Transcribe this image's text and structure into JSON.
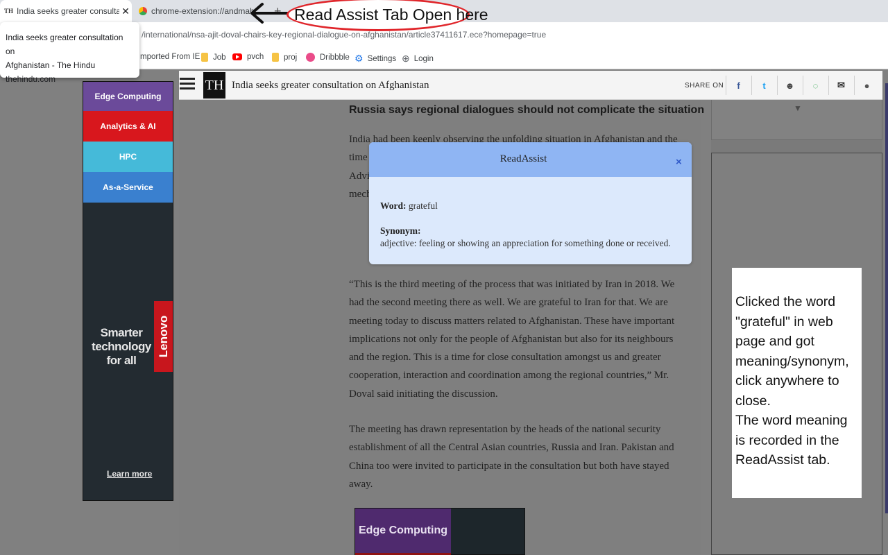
{
  "browser": {
    "tabs": [
      {
        "title": "India seeks greater consultation on",
        "favicon": "TH"
      },
      {
        "title": "chrome-extension://andmahekc"
      }
    ],
    "new_tab_symbol": "+",
    "url": "/international/nsa-ajit-doval-chairs-key-regional-dialogue-on-afghanistan/article37411617.ece?homepage=true",
    "bookmarks": [
      "mported From IE",
      "Job",
      "pvch",
      "proj",
      "Dribbble",
      "Settings",
      "Login"
    ],
    "hover_card": {
      "title_line1": "India seeks greater consultation on",
      "title_line2": "Afghanistan - The Hindu",
      "domain": "thehindu.com"
    }
  },
  "annotation_top": {
    "text": "Read Assist Tab Open here",
    "color": "#e0262b"
  },
  "site": {
    "logo": "TH",
    "headline": "India seeks greater consultation on Afghanistan",
    "share_label": "SHARE ON",
    "share_icons": [
      "facebook-icon",
      "twitter-icon",
      "reddit-icon",
      "whatsapp-icon",
      "email-icon",
      "comment-icon"
    ]
  },
  "article": {
    "subheading": "Russia says regional dialogues should not complicate the situation",
    "p1": "India had been keenly observing the unfolding situation in Afghanistan and the time had come for regional countries to work together. Indian National Security Adviser Ajit Doval said on Wednesday, seeking a common approach and a mechanism for the regional countries to continue",
    "p2": "“This is the third meeting of the process that was initiated by Iran in 2018. We had the second meeting there as well. We are grateful to Iran for that. We are meeting today to discuss matters related to Afghanistan. These have important implications not only for the people of Afghanistan but also for its neighbours and the region. This is a time for close consultation amongst us and greater cooperation, interaction and coordination among the regional countries,” Mr. Doval said initiating the discussion.",
    "p3": "The meeting has drawn representation by the heads of the national security establishment of all the Central Asian countries, Russia and Iran. Pakistan and China too were invited to participate in the consultation but both have stayed away."
  },
  "ad_left": {
    "categories": [
      {
        "label": "Edge Computing",
        "color": "#6b4a9a"
      },
      {
        "label": "Analytics & AI",
        "color": "#d8171d"
      },
      {
        "label": "HPC",
        "color": "#45bad9"
      },
      {
        "label": "As-a-Service",
        "color": "#3a80cf"
      }
    ],
    "slogan": "Smarter technology for all",
    "brand": "Lenovo",
    "cta": "Learn more"
  },
  "ad_inline": {
    "category": "Edge Computing"
  },
  "popup": {
    "title": "ReadAssist",
    "close": "×",
    "word_label": "Word:",
    "word": "grateful",
    "synonym_label": "Synonym:",
    "definition": "adjective: feeling or showing an appreciation for something done or received."
  },
  "note": {
    "text": "Clicked the word \"grateful\" in web page and got meaning/synonym, click anywhere to close.\nThe word meaning is recorded in the ReadAssist tab."
  }
}
